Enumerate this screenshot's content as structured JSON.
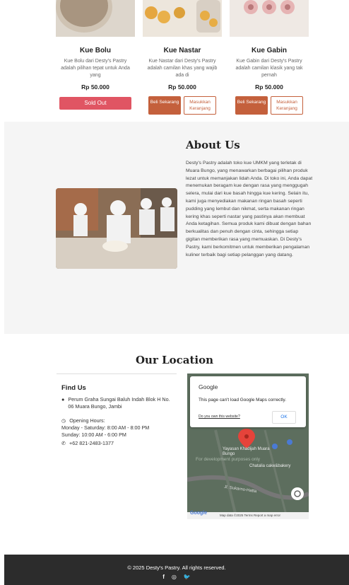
{
  "products": [
    {
      "name": "Kue Bolu",
      "desc": "Kue Bolu dari Desty's Pastry adalah pilihan tepat untuk Anda yang",
      "price": "Rp 50.000",
      "sold_out": "Sold Out"
    },
    {
      "name": "Kue Nastar",
      "desc": "Kue Nastar dari Desty's Pastry adalah camilan khas yang wajib ada di",
      "price": "Rp 50.000",
      "buy": "Beli Sekarang",
      "more": "Masukkan Keranjang"
    },
    {
      "name": "Kue Gabin",
      "desc": "Kue Gabin dari Desty's Pastry adalah camilan klasik yang tak pernah",
      "price": "Rp 50.000",
      "buy": "Beli Sekarang",
      "more": "Masukkan Keranjang"
    }
  ],
  "about": {
    "title": "About Us",
    "text": "Desty's Pastry adalah toko kue UMKM yang terletak di Muara Bungo, yang menawarkan berbagai pilihan produk lezat untuk memanjakan lidah Anda. Di toko ini, Anda dapat menemukan beragam kue dengan rasa yang menggugah selera, mulai dari kue basah hingga kue kering. Selain itu, kami juga menyediakan makanan ringan basah seperti pudding yang lembut dan nikmat, serta makanan ringan kering khas seperti nastar yang pastinya akan membuat Anda ketagihan. Semua produk kami dibuat dengan bahan berkualitas dan penuh dengan cinta, sehingga setiap gigitan memberikan rasa yang memuaskan. Di Desty's Pastry, kami berkomitmen untuk memberikan pengalaman kuliner terbaik bagi setiap pelanggan yang datang."
  },
  "location": {
    "title": "Our Location",
    "find_us": "Find Us",
    "address": "Perum Graha Sungai Baluh Indah Blok H No. 06 Muara Bungo, Jambi",
    "hours_label": "Opening Hours:",
    "hours_weekday": "Monday - Saturday: 8:00 AM - 8:00 PM",
    "hours_sunday": "Sunday: 10:00 AM - 6:00 PM",
    "phone": "+62 821-2483-1377"
  },
  "map": {
    "brand": "Google",
    "error": "This page can't load Google Maps correctly.",
    "own_site": "Do you own this website?",
    "ok": "OK",
    "dev_text": "For development purposes only",
    "place": "Yayasan Khadijah Muara Bungo",
    "place2": "Chatalia cake&bakery",
    "street": "Jl. Sukarno-Hatta",
    "logo": "Google",
    "attribution": "Map data ©2025  Terms  Report a map error"
  },
  "footer": {
    "copyright": "© 2025 Desty's Pastry. All rights reserved."
  },
  "icons": {
    "facebook": "f",
    "instagram": "◎",
    "twitter": "🐦"
  },
  "colors": {
    "sold_out": "#e05563",
    "accent": "#c4603c",
    "footer": "#2c2c2c"
  }
}
